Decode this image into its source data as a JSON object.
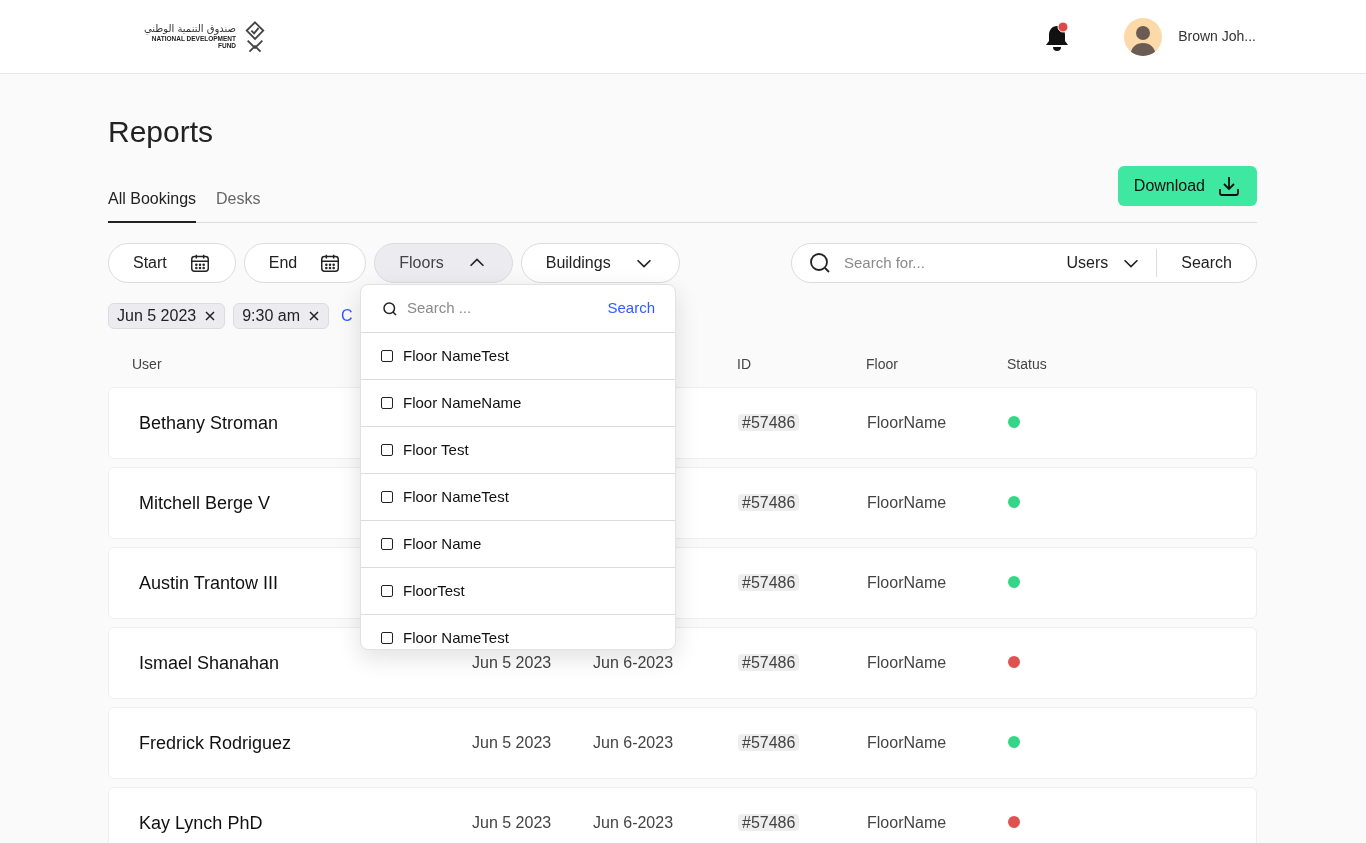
{
  "header": {
    "logo": {
      "arabic": "صندوق التنمية الوطني",
      "english": "NATIONAL DEVELOPMENT",
      "english_2": "FUND"
    },
    "notifications": {
      "unread": true
    },
    "user": {
      "name": "Brown Joh..."
    }
  },
  "page_title": "Reports",
  "download_button": "Download",
  "tabs": [
    {
      "label": "All Bookings",
      "selected": true
    },
    {
      "label": "Desks",
      "selected": false
    }
  ],
  "filters": [
    {
      "label": "Start",
      "kind": "date",
      "selected": false
    },
    {
      "label": "End",
      "kind": "date",
      "selected": false
    },
    {
      "label": "Floors",
      "kind": "dropdown",
      "selected": true
    },
    {
      "label": "Buildings",
      "kind": "dropdown",
      "selected": false
    }
  ],
  "search": {
    "placeholder": "Search for...",
    "scope": "Users",
    "button": "Search"
  },
  "chips": [
    "Jun 5 2023",
    "9:30 am"
  ],
  "clear_link": "C",
  "floors_dropdown": {
    "placeholder": "Search ...",
    "button": "Search",
    "options": [
      {
        "label": "Floor NameTest",
        "checked": false
      },
      {
        "label": "Floor NameName",
        "checked": false
      },
      {
        "label": "Floor Test",
        "checked": false
      },
      {
        "label": "Floor NameTest",
        "checked": false
      },
      {
        "label": "Floor Name",
        "checked": false
      },
      {
        "label": "FloorTest",
        "checked": false
      },
      {
        "label": "Floor NameTest",
        "checked": false
      }
    ]
  },
  "table": {
    "columns": [
      "User",
      "ID",
      "Floor",
      "Status"
    ],
    "rows": [
      {
        "user": "Bethany Stroman",
        "id": "#57486",
        "floor": "FloorName",
        "color": "#34d585"
      },
      {
        "user": "Mitchell Berge V",
        "id": "#57486",
        "floor": "FloorName",
        "color": "#34d585"
      },
      {
        "user": "Austin Trantow III",
        "id": "#57486",
        "floor": "FloorName",
        "color": "#34d585"
      },
      {
        "user": "Ismael Shanahan",
        "start": "Jun 5 2023",
        "end": "Jun 6-2023",
        "id": "#57486",
        "floor": "FloorName",
        "color": "#e05252"
      },
      {
        "user": "Fredrick Rodriguez",
        "start": "Jun 5 2023",
        "end": "Jun 6-2023",
        "id": "#57486",
        "floor": "FloorName",
        "color": "#34d585"
      },
      {
        "user": "Kay Lynch PhD",
        "start": "Jun 5 2023",
        "end": "Jun 6-2023",
        "id": "#57486",
        "floor": "FloorName",
        "color": "#e05252"
      }
    ]
  }
}
